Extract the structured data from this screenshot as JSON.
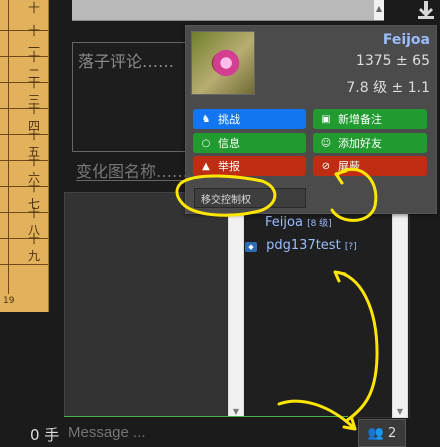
{
  "board": {
    "coords": [
      "十",
      "十一",
      "十二",
      "十三",
      "十四",
      "十五",
      "十六",
      "十七",
      "十八",
      "十九"
    ],
    "row_count": "19"
  },
  "comment": {
    "placeholder": "落子评论……"
  },
  "variation": {
    "placeholder": "变化图名称……"
  },
  "popup": {
    "username": "Feijoa",
    "rating": "1375 ± 65",
    "rank": "7.8 级 ± 1.1",
    "buttons": [
      {
        "label": "挑战",
        "icon": "challenge-icon",
        "color": "#1276f2"
      },
      {
        "label": "新增备注",
        "icon": "note-icon",
        "color": "#219a2f"
      },
      {
        "label": "信息",
        "icon": "message-icon",
        "color": "#219a2f"
      },
      {
        "label": "添加好友",
        "icon": "add-friend-icon",
        "color": "#219a2f"
      },
      {
        "label": "举报",
        "icon": "report-icon",
        "color": "#be2c12"
      },
      {
        "label": "屏蔽",
        "icon": "block-icon",
        "color": "#be2c12"
      }
    ],
    "transfer_label": "移交控制权"
  },
  "players": [
    {
      "name": "Feijoa",
      "tag": "[8 级]"
    },
    {
      "name": "pdg137test",
      "tag": "[?]"
    }
  ],
  "bottom": {
    "move_count": "0 手",
    "message_placeholder": "Message ...",
    "users_count": "2"
  }
}
